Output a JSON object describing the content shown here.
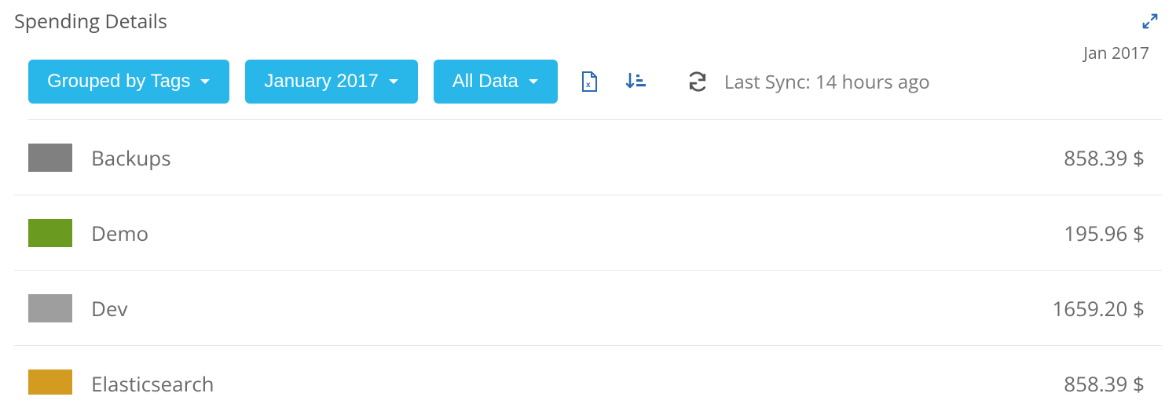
{
  "title": "Spending Details",
  "date_badge": "Jan 2017",
  "toolbar": {
    "group_label": "Grouped by Tags",
    "period_label": "January 2017",
    "scope_label": "All Data",
    "sync_text": "Last Sync: 14 hours ago"
  },
  "colors": {
    "accent": "#29b6e8",
    "icon_blue": "#2b6cb0",
    "icon_gray": "#555"
  },
  "rows": [
    {
      "label": "Backups",
      "amount": "858.39 $",
      "color": "#808080"
    },
    {
      "label": "Demo",
      "amount": "195.96 $",
      "color": "#6a9a1f"
    },
    {
      "label": "Dev",
      "amount": "1659.20 $",
      "color": "#9e9e9e"
    },
    {
      "label": "Elasticsearch",
      "amount": "858.39 $",
      "color": "#d39b1f"
    }
  ]
}
